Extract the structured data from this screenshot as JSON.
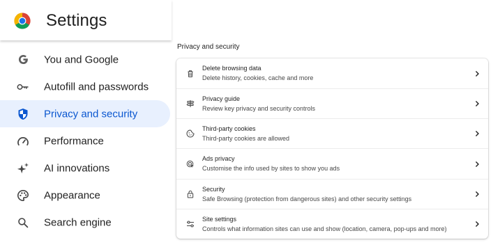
{
  "app": {
    "title": "Settings"
  },
  "colors": {
    "accent": "#0b57d0",
    "active_bg": "#e8f0fe"
  },
  "sidebar": {
    "items": [
      {
        "label": "You and Google",
        "icon": "google-g-icon",
        "active": false
      },
      {
        "label": "Autofill and passwords",
        "icon": "key-icon",
        "active": false
      },
      {
        "label": "Privacy and security",
        "icon": "shield-icon",
        "active": true
      },
      {
        "label": "Performance",
        "icon": "speedometer-icon",
        "active": false
      },
      {
        "label": "AI innovations",
        "icon": "sparkle-icon",
        "active": false
      },
      {
        "label": "Appearance",
        "icon": "palette-icon",
        "active": false
      },
      {
        "label": "Search engine",
        "icon": "search-icon",
        "active": false
      }
    ]
  },
  "main": {
    "section_title": "Privacy and security",
    "rows": [
      {
        "title": "Delete browsing data",
        "subtitle": "Delete history, cookies, cache and more",
        "icon": "trash-icon"
      },
      {
        "title": "Privacy guide",
        "subtitle": "Review key privacy and security controls",
        "icon": "signpost-icon"
      },
      {
        "title": "Third-party cookies",
        "subtitle": "Third-party cookies are allowed",
        "icon": "cookie-icon"
      },
      {
        "title": "Ads privacy",
        "subtitle": "Customise the info used by sites to show you ads",
        "icon": "ads-privacy-icon"
      },
      {
        "title": "Security",
        "subtitle": "Safe Browsing (protection from dangerous sites) and other security settings",
        "icon": "lock-icon"
      },
      {
        "title": "Site settings",
        "subtitle": "Controls what information sites can use and show (location, camera, pop-ups and more)",
        "icon": "sliders-icon"
      }
    ]
  }
}
